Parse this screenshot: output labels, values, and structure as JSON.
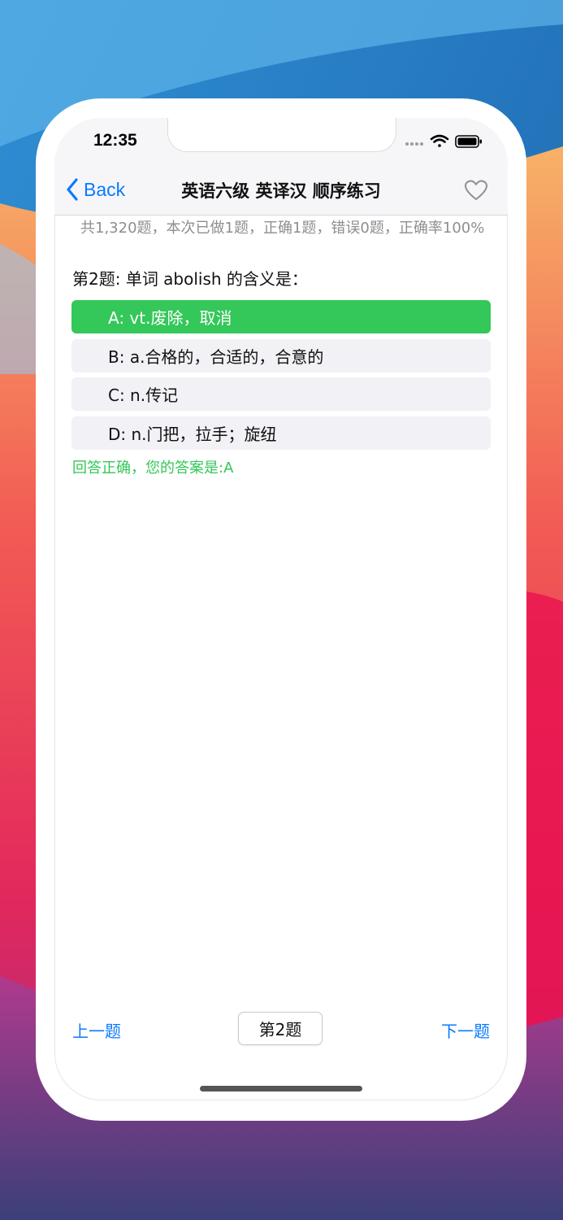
{
  "status_bar": {
    "time": "12:35"
  },
  "nav": {
    "back_label": "Back",
    "title": "英语六级 英译汉 顺序练习"
  },
  "stats": "共1,320题，本次已做1题，正确1题，错误0题，正确率100%",
  "question": "第2题: 单词 abolish 的含义是：",
  "options": [
    {
      "label": "A: vt.废除，取消",
      "state": "correct"
    },
    {
      "label": "B: a.合格的，合适的，合意的",
      "state": "normal"
    },
    {
      "label": "C: n.传记",
      "state": "normal"
    },
    {
      "label": "D: n.门把，拉手；旋纽",
      "state": "normal"
    }
  ],
  "result": "回答正确，您的答案是:A",
  "footer": {
    "prev_label": "上一题",
    "current_label": "第2题",
    "next_label": "下一题"
  },
  "colors": {
    "accent": "#0a7aff",
    "correct": "#34c759",
    "option_bg": "#f1f1f6",
    "stats_text": "#8e8e93"
  },
  "icons": {
    "back": "chevron-left-icon",
    "favorite": "heart-outline-icon",
    "signal": "signal-dots-icon",
    "wifi": "wifi-icon",
    "battery": "battery-icon"
  }
}
